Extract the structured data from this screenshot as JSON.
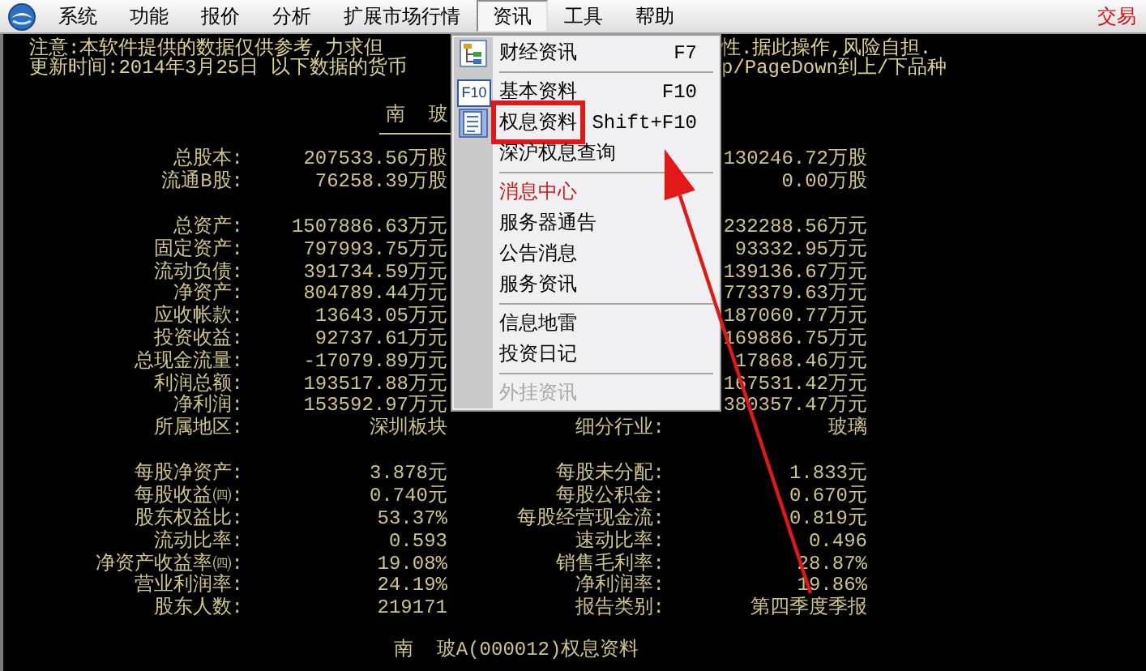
{
  "menu_bar": {
    "items": [
      {
        "label": "系统",
        "selected": false
      },
      {
        "label": "功能",
        "selected": false
      },
      {
        "label": "报价",
        "selected": false
      },
      {
        "label": "分析",
        "selected": false
      },
      {
        "label": "扩展市场行情",
        "selected": false
      },
      {
        "label": "资讯",
        "selected": true
      },
      {
        "label": "工具",
        "selected": false
      },
      {
        "label": "帮助",
        "selected": false
      }
    ],
    "trade_link": "交易"
  },
  "notice": {
    "line_1_left": "注意:本软件提供的数据仅供参考,力求但",
    "line_1_right": "性.据此操作,风险自担.",
    "line_2_left": "更新时间:2014年3月25日 以下数据的货币",
    "line_2_right": "p/PageDown到上/下品种"
  },
  "report": {
    "title": "南  玻",
    "sections": [
      {
        "rows": [
          {
            "label": "总股本:",
            "value": "207533.56万股",
            "value_2": "130246.72万股"
          },
          {
            "label": "流通B股:",
            "value": "76258.39万股",
            "value_2": "0.00万股"
          }
        ]
      },
      {
        "rows": [
          {
            "label": "总资产:",
            "value": "1507886.63万元",
            "value_2": "232288.56万元"
          },
          {
            "label": "固定资产:",
            "value": "797993.75万元",
            "value_2": "93332.95万元"
          },
          {
            "label": "流动负债:",
            "value": "391734.59万元",
            "value_2": "139136.67万元"
          },
          {
            "label": "净资产:",
            "value": "804789.44万元",
            "value_2": "773379.63万元"
          },
          {
            "label": "应收帐款:",
            "value": "13643.05万元",
            "value_2": "187060.77万元"
          },
          {
            "label": "投资收益:",
            "value": "92737.61万元",
            "value_2": "169886.75万元"
          },
          {
            "label": "总现金流量:",
            "value": "-17079.89万元",
            "value_2": "17868.46万元"
          },
          {
            "label": "利润总额:",
            "value": "193517.88万元",
            "value_2": "167531.42万元"
          },
          {
            "label": "净利润:",
            "value": "153592.97万元",
            "value_2": "380357.47万元"
          },
          {
            "label": "所属地区:",
            "value": "深圳板块",
            "label_2": "细分行业:",
            "value_2": "玻璃"
          }
        ]
      },
      {
        "rows": [
          {
            "label": "每股净资产:",
            "value": "3.878元",
            "label_2": "每股未分配:",
            "value_2": "1.833元"
          },
          {
            "label": "每股收益㈣:",
            "value": "0.740元",
            "label_2": "每股公积金:",
            "value_2": "0.670元"
          },
          {
            "label": "股东权益比:",
            "value": "53.37%",
            "label_2": "每股经营现金流:",
            "value_2": "0.819元"
          },
          {
            "label": "流动比率:",
            "value": "0.593",
            "label_2": "速动比率:",
            "value_2": "0.496"
          },
          {
            "label": "净资产收益率㈣:",
            "value": "19.08%",
            "label_2": "销售毛利率:",
            "value_2": "28.87%"
          },
          {
            "label": "营业利润率:",
            "value": "24.19%",
            "label_2": "净利润率:",
            "value_2": "19.86%"
          },
          {
            "label": "股东人数:",
            "value": "219171",
            "label_2": "报告类别:",
            "value_2": "第四季度季报"
          }
        ]
      }
    ],
    "footer": "南  玻A(000012)权息资料"
  },
  "dropdown": {
    "items": [
      {
        "kind": "item",
        "label": "财经资讯",
        "shortcut": "F7",
        "icon": true,
        "disabled": false,
        "emphasized": false,
        "highlighted": false
      },
      {
        "kind": "separator"
      },
      {
        "kind": "item",
        "label": "基本资料",
        "shortcut": "F10",
        "icon_text": "F10",
        "disabled": false,
        "emphasized": false,
        "highlighted": false
      },
      {
        "kind": "item",
        "label": "权息资料",
        "shortcut": "Shift+F10",
        "icon": true,
        "disabled": false,
        "emphasized": false,
        "highlighted": true
      },
      {
        "kind": "item",
        "label": "深沪权息查询",
        "disabled": false,
        "emphasized": false,
        "highlighted": false
      },
      {
        "kind": "separator"
      },
      {
        "kind": "item",
        "label": "消息中心",
        "disabled": false,
        "emphasized": true,
        "highlighted": false
      },
      {
        "kind": "item",
        "label": "服务器通告",
        "disabled": false,
        "emphasized": false,
        "highlighted": false
      },
      {
        "kind": "item",
        "label": "公告消息",
        "disabled": false,
        "emphasized": false,
        "highlighted": false
      },
      {
        "kind": "item",
        "label": "服务资讯",
        "disabled": false,
        "emphasized": false,
        "highlighted": false
      },
      {
        "kind": "separator"
      },
      {
        "kind": "item",
        "label": "信息地雷",
        "disabled": false,
        "emphasized": false,
        "highlighted": false
      },
      {
        "kind": "item",
        "label": "投资日记",
        "disabled": false,
        "emphasized": false,
        "highlighted": false
      },
      {
        "kind": "separator"
      },
      {
        "kind": "item",
        "label": "外挂资讯",
        "disabled": true,
        "emphasized": false,
        "highlighted": false
      }
    ]
  }
}
